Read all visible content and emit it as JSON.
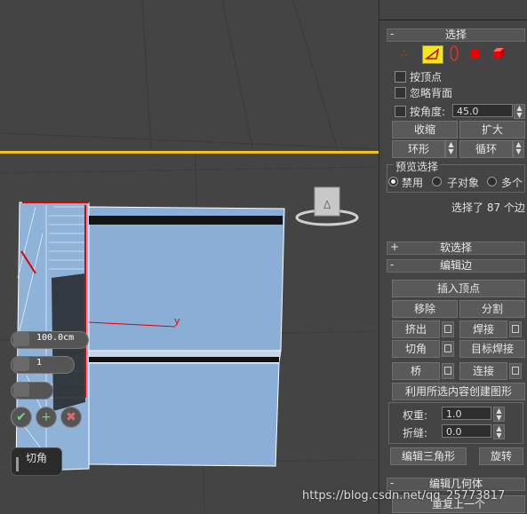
{
  "viewport": {
    "axis_label": "y",
    "caddy": {
      "title": "切角",
      "amount": "100.0cm",
      "segments": "1",
      "ok_icon": "check-icon",
      "apply_icon": "plus-icon",
      "cancel_icon": "x-icon"
    }
  },
  "panel": {
    "selection": {
      "header": "选择",
      "collapse_sign": "-",
      "modes": [
        "vertex",
        "edge",
        "border",
        "polygon",
        "element"
      ],
      "active_mode": "edge",
      "by_vertex": "按顶点",
      "ignore_backfacing": "忽略背面",
      "by_angle": "按角度:",
      "angle_value": "45.0",
      "shrink": "收缩",
      "grow": "扩大",
      "ring": "环形",
      "loop": "循环",
      "preview_group": "预览选择",
      "preview_options": [
        "禁用",
        "子对象",
        "多个"
      ],
      "preview_selected": "禁用",
      "status": "选择了 87 个边"
    },
    "soft_selection": {
      "header": "软选择",
      "collapse_sign": "+"
    },
    "edit_edges": {
      "header": "编辑边",
      "collapse_sign": "-",
      "insert_vertex": "插入顶点",
      "remove": "移除",
      "split": "分割",
      "extrude": "挤出",
      "weld": "焊接",
      "chamfer": "切角",
      "target_weld": "目标焊接",
      "bridge": "桥",
      "connect": "连接",
      "create_shape": "利用所选内容创建图形",
      "weight_label": "权重:",
      "weight_value": "1.0",
      "crease_label": "折缝:",
      "crease_value": "0.0",
      "edit_tri": "编辑三角形",
      "turn": "旋转"
    },
    "edit_geometry": {
      "header": "编辑几何体",
      "collapse_sign": "-",
      "repeat_last": "重复上一个"
    }
  },
  "watermark": "https://blog.csdn.net/qq_25773817",
  "colors": {
    "accent_yellow": "#f0c418",
    "selection_red": "#e00000",
    "mesh_blue": "#8aaed6"
  }
}
